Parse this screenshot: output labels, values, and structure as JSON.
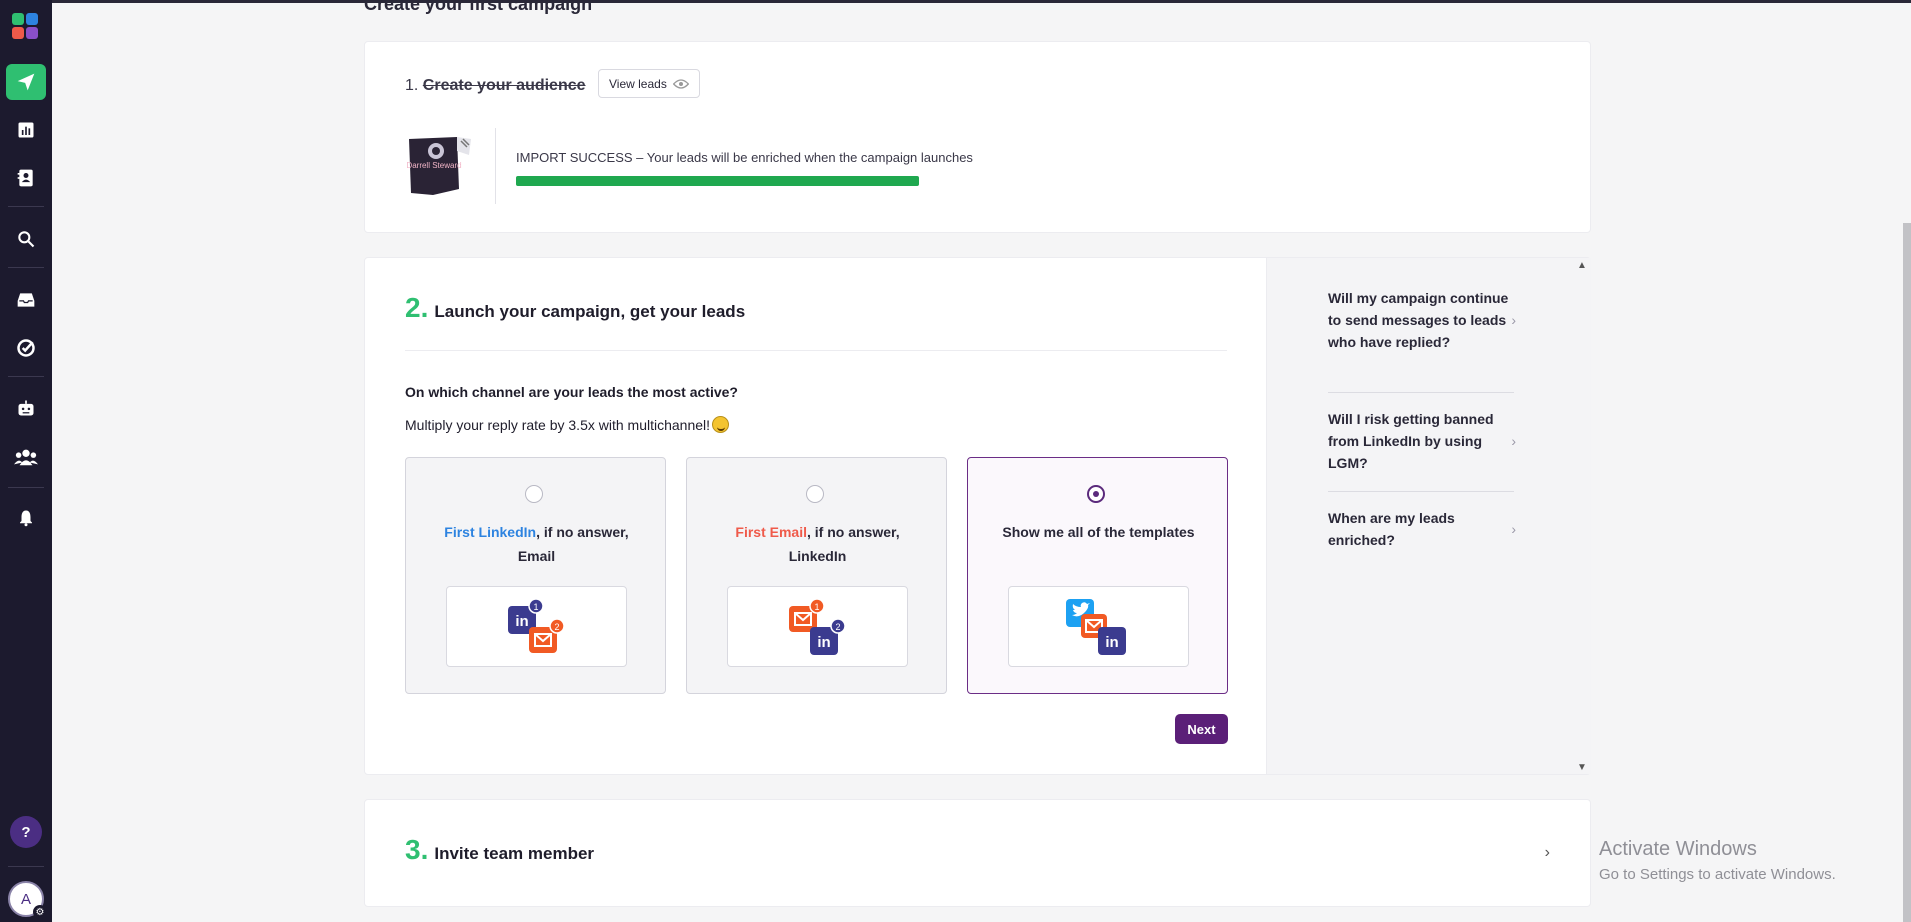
{
  "page": {
    "header": "Create your first campaign"
  },
  "sidebar": {
    "help": "?",
    "avatar_initial": "A"
  },
  "step1": {
    "number": "1.",
    "title": "Create your audience",
    "view_leads": "View leads",
    "card_name": "Darrell Steward",
    "import_text": "IMPORT SUCCESS – Your leads will be enriched when the campaign launches",
    "progress": 1.0
  },
  "step2": {
    "number": "2.",
    "title": "Launch your campaign, get your leads",
    "question": "On which channel are your leads the most active?",
    "multiply": "Multiply your reply rate by 3.5x with multichannel!",
    "options": [
      {
        "highlight": "First LinkedIn",
        "rest": ", if no answer, Email",
        "selected": false
      },
      {
        "highlight": "First Email",
        "rest": ", if no answer, LinkedIn",
        "selected": false
      },
      {
        "label": "Show me all of the templates",
        "selected": true
      }
    ],
    "next": "Next",
    "faq": [
      "Will my campaign continue to send messages to leads who have replied?",
      "Will I risk getting banned from LinkedIn by using LGM?",
      "When are my leads enriched?"
    ]
  },
  "step3": {
    "number": "3.",
    "title": "Invite team member"
  },
  "watermark": {
    "line1": "Activate Windows",
    "line2": "Go to Settings to activate Windows."
  },
  "colors": {
    "accent": "#5b1f78",
    "green": "#2fbf71",
    "sidebar": "#1c1a2e"
  }
}
